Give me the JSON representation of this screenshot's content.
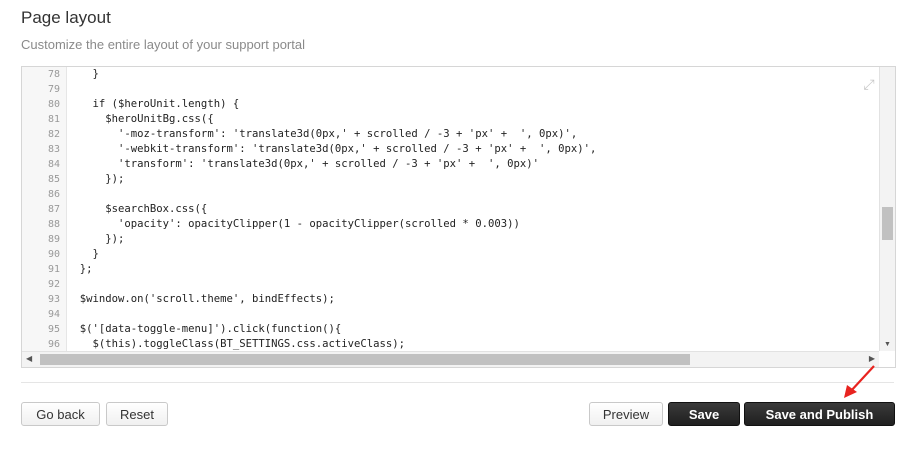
{
  "page": {
    "title": "Page layout",
    "subtitle": "Customize the entire layout of your support portal"
  },
  "editor": {
    "lines": [
      {
        "n": "78",
        "code": "    }"
      },
      {
        "n": "79",
        "code": ""
      },
      {
        "n": "80",
        "code": "    if ($heroUnit.length) {"
      },
      {
        "n": "81",
        "code": "      $heroUnitBg.css({"
      },
      {
        "n": "82",
        "code": "        '-moz-transform': 'translate3d(0px,' + scrolled / -3 + 'px' +  ', 0px)',"
      },
      {
        "n": "83",
        "code": "        '-webkit-transform': 'translate3d(0px,' + scrolled / -3 + 'px' +  ', 0px)',"
      },
      {
        "n": "84",
        "code": "        'transform': 'translate3d(0px,' + scrolled / -3 + 'px' +  ', 0px)'"
      },
      {
        "n": "85",
        "code": "      });"
      },
      {
        "n": "86",
        "code": ""
      },
      {
        "n": "87",
        "code": "      $searchBox.css({"
      },
      {
        "n": "88",
        "code": "        'opacity': opacityClipper(1 - opacityClipper(scrolled * 0.003))"
      },
      {
        "n": "89",
        "code": "      });"
      },
      {
        "n": "90",
        "code": "    }"
      },
      {
        "n": "91",
        "code": "  };"
      },
      {
        "n": "92",
        "code": ""
      },
      {
        "n": "93",
        "code": "  $window.on('scroll.theme', bindEffects);"
      },
      {
        "n": "94",
        "code": ""
      },
      {
        "n": "95",
        "code": "  $('[data-toggle-menu]').click(function(){"
      },
      {
        "n": "96",
        "code": "    $(this).toggleClass(BT_SETTINGS.css.activeClass);"
      }
    ]
  },
  "buttons": {
    "go_back": "Go back",
    "reset": "Reset",
    "preview": "Preview",
    "save": "Save",
    "save_publish": "Save and Publish"
  },
  "colors": {
    "annotation_arrow": "#e8231f",
    "dark_button": "#262626"
  }
}
